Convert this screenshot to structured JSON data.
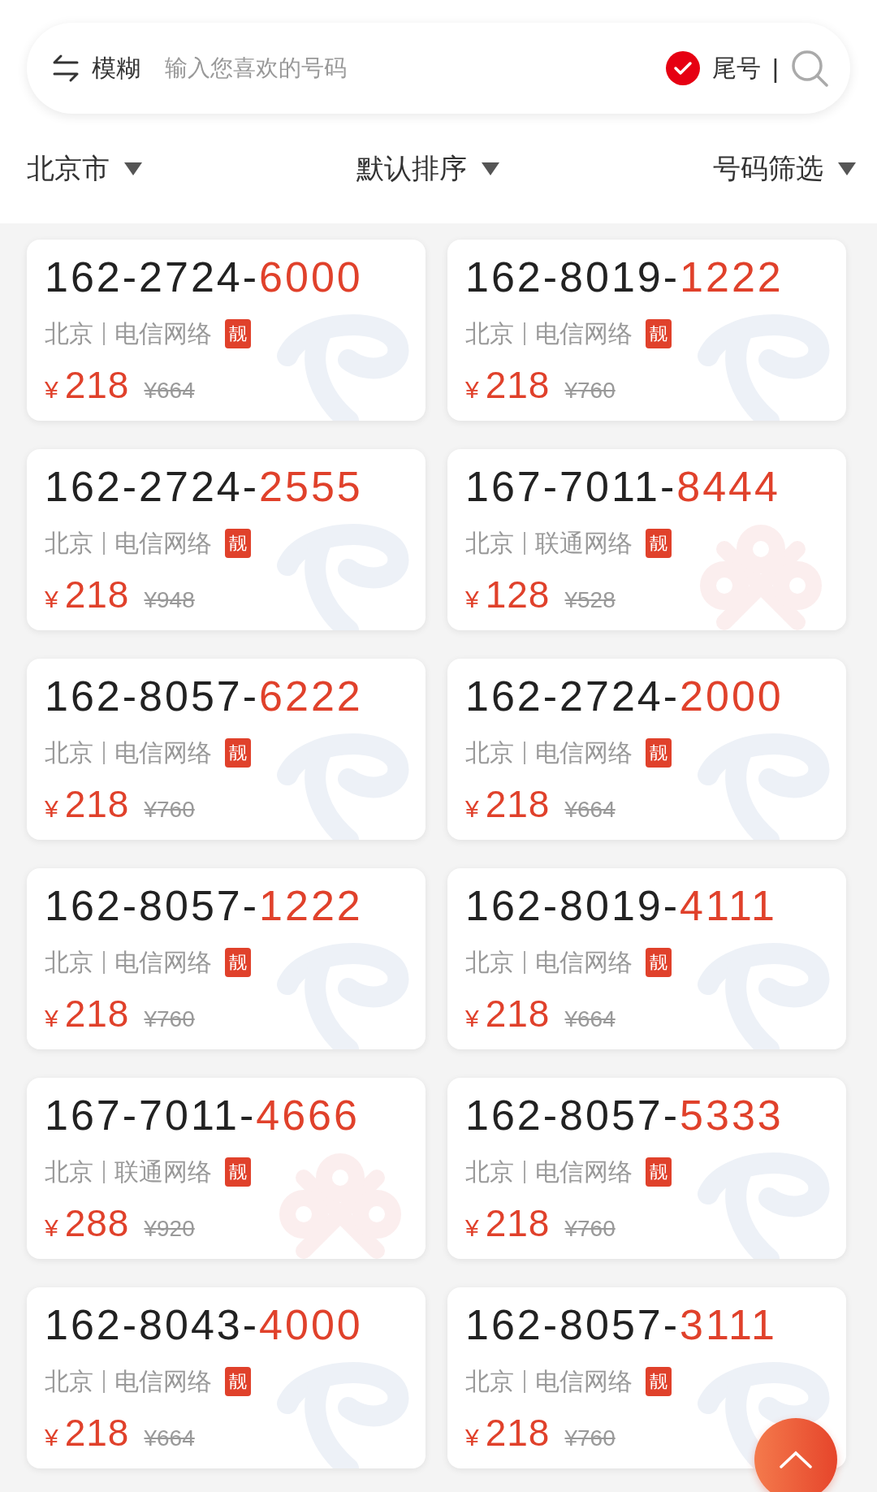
{
  "search": {
    "mode": "模糊",
    "placeholder": "输入您喜欢的号码",
    "tail_match": {
      "label": "尾号",
      "checked": true
    },
    "separator": "|"
  },
  "filters": [
    {
      "label": "北京市"
    },
    {
      "label": "默认排序"
    },
    {
      "label": "号码筛选"
    }
  ],
  "numbers": [
    {
      "prefix": "162-2724-",
      "suffix": "6000",
      "city": "北京",
      "network": "电信网络",
      "badge": "靓",
      "currency": "¥",
      "price": "218",
      "original_price": "¥664",
      "kind": "telecom"
    },
    {
      "prefix": "162-8019-",
      "suffix": "1222",
      "city": "北京",
      "network": "电信网络",
      "badge": "靓",
      "currency": "¥",
      "price": "218",
      "original_price": "¥760",
      "kind": "telecom"
    },
    {
      "prefix": "162-2724-",
      "suffix": "2555",
      "city": "北京",
      "network": "电信网络",
      "badge": "靓",
      "currency": "¥",
      "price": "218",
      "original_price": "¥948",
      "kind": "telecom"
    },
    {
      "prefix": "167-7011-",
      "suffix": "8444",
      "city": "北京",
      "network": "联通网络",
      "badge": "靓",
      "currency": "¥",
      "price": "128",
      "original_price": "¥528",
      "kind": "unicom"
    },
    {
      "prefix": "162-8057-",
      "suffix": "6222",
      "city": "北京",
      "network": "电信网络",
      "badge": "靓",
      "currency": "¥",
      "price": "218",
      "original_price": "¥760",
      "kind": "telecom"
    },
    {
      "prefix": "162-2724-",
      "suffix": "2000",
      "city": "北京",
      "network": "电信网络",
      "badge": "靓",
      "currency": "¥",
      "price": "218",
      "original_price": "¥664",
      "kind": "telecom"
    },
    {
      "prefix": "162-8057-",
      "suffix": "1222",
      "city": "北京",
      "network": "电信网络",
      "badge": "靓",
      "currency": "¥",
      "price": "218",
      "original_price": "¥760",
      "kind": "telecom"
    },
    {
      "prefix": "162-8019-",
      "suffix": "4111",
      "city": "北京",
      "network": "电信网络",
      "badge": "靓",
      "currency": "¥",
      "price": "218",
      "original_price": "¥664",
      "kind": "telecom"
    },
    {
      "prefix": "167-7011-",
      "suffix": "4666",
      "city": "北京",
      "network": "联通网络",
      "badge": "靓",
      "currency": "¥",
      "price": "288",
      "original_price": "¥920",
      "kind": "unicom"
    },
    {
      "prefix": "162-8057-",
      "suffix": "5333",
      "city": "北京",
      "network": "电信网络",
      "badge": "靓",
      "currency": "¥",
      "price": "218",
      "original_price": "¥760",
      "kind": "telecom"
    },
    {
      "prefix": "162-8043-",
      "suffix": "4000",
      "city": "北京",
      "network": "电信网络",
      "badge": "靓",
      "currency": "¥",
      "price": "218",
      "original_price": "¥664",
      "kind": "telecom"
    },
    {
      "prefix": "162-8057-",
      "suffix": "3111",
      "city": "北京",
      "network": "电信网络",
      "badge": "靓",
      "currency": "¥",
      "price": "218",
      "original_price": "¥760",
      "kind": "telecom"
    }
  ]
}
